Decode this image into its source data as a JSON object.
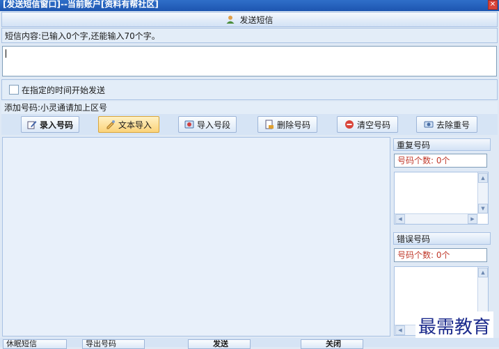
{
  "window": {
    "title": "[发送短信窗口]--当前账户[资料有帮社区]",
    "close_label": "✕"
  },
  "header": {
    "send_label": "发送短信"
  },
  "sms": {
    "content_label": "短信内容:已输入0个字,还能输入70个字。",
    "content_value": ""
  },
  "schedule": {
    "checkbox_label": "在指定的时间开始发送"
  },
  "numbers": {
    "add_label": "添加号码:小灵通请加上区号",
    "buttons": {
      "manual": "录入号码",
      "text_import": "文本导入",
      "segment_import": "导入号段",
      "delete": "删除号码",
      "clear": "清空号码",
      "dedupe": "去除重号"
    }
  },
  "duplicates": {
    "title": "重复号码",
    "count_text": "号码个数: 0个"
  },
  "errors": {
    "title": "错误号码",
    "count_text": "号码个数: 0个"
  },
  "watermark": "最需教育",
  "bottom": {
    "buttons": [
      "休眠短信",
      "导出号码",
      "发送",
      "关闭"
    ]
  },
  "colors": {
    "title_bar": "#1d55b0",
    "count_text": "#c0392b",
    "accent_button": "#fbd37a"
  }
}
